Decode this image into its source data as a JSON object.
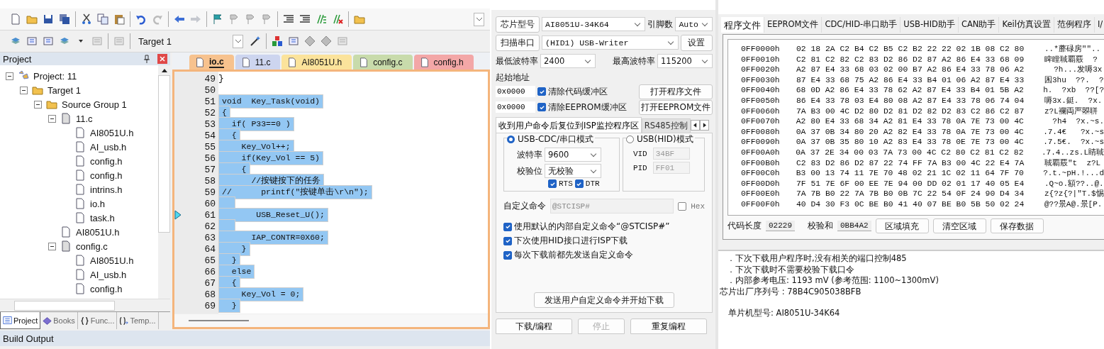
{
  "ide": {
    "target_select": "Target 1",
    "project_panel": {
      "title": "Project",
      "tree": [
        {
          "label": "Project: 11",
          "kind": "project",
          "expanded": true,
          "children": [
            {
              "label": "Target 1",
              "kind": "target",
              "expanded": true,
              "children": [
                {
                  "label": "Source Group 1",
                  "kind": "group",
                  "expanded": true,
                  "children": [
                    {
                      "label": "11.c",
                      "kind": "source",
                      "expanded": true,
                      "children": [
                        {
                          "label": "AI8051U.h",
                          "kind": "header"
                        },
                        {
                          "label": "AI_usb.h",
                          "kind": "header"
                        },
                        {
                          "label": "config.h",
                          "kind": "header"
                        },
                        {
                          "label": "config.h",
                          "kind": "header"
                        },
                        {
                          "label": "intrins.h",
                          "kind": "header"
                        },
                        {
                          "label": "io.h",
                          "kind": "header"
                        },
                        {
                          "label": "task.h",
                          "kind": "header"
                        }
                      ]
                    },
                    {
                      "label": "AI8051U.h",
                      "kind": "header"
                    },
                    {
                      "label": "config.c",
                      "kind": "source",
                      "expanded": true,
                      "children": [
                        {
                          "label": "AI8051U.h",
                          "kind": "header"
                        },
                        {
                          "label": "AI_usb.h",
                          "kind": "header"
                        },
                        {
                          "label": "config.h",
                          "kind": "header"
                        }
                      ]
                    }
                  ]
                }
              ]
            }
          ]
        }
      ],
      "tabs": [
        {
          "label": "Project",
          "kind": "project",
          "selected": true
        },
        {
          "label": "Books",
          "kind": "books",
          "selected": false
        },
        {
          "label": "Func...",
          "kind": "functions",
          "selected": false
        },
        {
          "label": "Temp...",
          "kind": "templates",
          "selected": false
        }
      ]
    },
    "editor_tabs": [
      {
        "label": "io.c",
        "color": "#f7c28e",
        "selected": true
      },
      {
        "label": "11.c",
        "color": "#cdd5ef",
        "selected": false
      },
      {
        "label": "AI8051U.h",
        "color": "#fbe39b",
        "selected": false
      },
      {
        "label": "config.c",
        "color": "#c8dbab",
        "selected": false
      },
      {
        "label": "config.h",
        "color": "#f3a7a7",
        "selected": false
      }
    ],
    "code": [
      {
        "number": "49",
        "text": "}",
        "selected": false,
        "current": false
      },
      {
        "number": "50",
        "selected": false,
        "current": false
      },
      {
        "number": "51",
        "text": "void  Key_Task(void)",
        "selected": true,
        "current": false
      },
      {
        "number": "52",
        "text": "{",
        "selected": true,
        "current": false
      },
      {
        "number": "53",
        "text": "  if( P33==0 )",
        "selected": true,
        "current": false
      },
      {
        "number": "54",
        "text": "  {",
        "selected": true,
        "current": false
      },
      {
        "number": "55",
        "text": "    Key_Vol++;",
        "selected": true,
        "current": false
      },
      {
        "number": "56",
        "text": "    if(Key_Vol == 5)",
        "selected": true,
        "current": false
      },
      {
        "number": "57",
        "text": "    {",
        "selected": true,
        "current": false
      },
      {
        "number": "58",
        "text": "      //按键按下的任务",
        "selected": true,
        "current": false
      },
      {
        "number": "59",
        "text": "//      printf(\"按键单击\\r\\n\");",
        "selected": true,
        "current": false
      },
      {
        "number": "60",
        "selected": true,
        "current": false
      },
      {
        "number": "61",
        "text": "       USB_Reset_U();",
        "selected": true,
        "current": true
      },
      {
        "number": "62",
        "selected": true,
        "current": false
      },
      {
        "number": "63",
        "text": "      IAP_CONTR=0X60;",
        "selected": true,
        "current": false
      },
      {
        "number": "64",
        "text": "    }",
        "selected": true,
        "current": false
      },
      {
        "number": "65",
        "text": "  }",
        "selected": true,
        "current": false
      },
      {
        "number": "66",
        "text": "  else",
        "selected": true,
        "current": false
      },
      {
        "number": "67",
        "text": "  {",
        "selected": true,
        "current": false
      },
      {
        "number": "68",
        "text": "    Key_Vol = 0;",
        "selected": true,
        "current": false
      },
      {
        "number": "69",
        "text": "  }",
        "selected": true,
        "current": false
      }
    ],
    "build_output": {
      "title": "Build Output"
    }
  },
  "isp": {
    "chip_button": "芯片型号",
    "chip_select": "AI8051U-34K64",
    "pins_label": "引脚数",
    "pins_select": "Auto",
    "scan_button": "扫描串口",
    "port_select": "(HID1) USB-Writer",
    "settings_button": "设置",
    "min_baud_label": "最低波特率",
    "min_baud": "2400",
    "max_baud_label": "最高波特率",
    "max_baud": "115200",
    "start_address_label": "起始地址",
    "address_rows": [
      {
        "address": "0x0000",
        "label": "清除代码缓冲区",
        "checked": true,
        "button": "打开程序文件"
      },
      {
        "address": "0x0000",
        "label": "清除EEPROM缓冲区",
        "checked": true,
        "button": "打开EEPROM文件"
      }
    ],
    "tabs": [
      {
        "label": "收到用户命令后复位到ISP监控程序区",
        "selected": true
      },
      {
        "label": "RS485控制",
        "selected": false
      }
    ],
    "modes": [
      {
        "kind": "cdc",
        "label": "USB-CDC/串口模式",
        "selected": true,
        "baud_label": "波特率",
        "baud": "9600",
        "parity_label": "校验位",
        "parity": "无校验",
        "flags": [
          {
            "label": "RTS",
            "checked": true
          },
          {
            "label": "DTR",
            "checked": true
          }
        ]
      },
      {
        "kind": "hid",
        "label": "USB(HID)模式",
        "selected": false,
        "vid_label": "VID",
        "vid": "34BF",
        "pid_label": "PID",
        "pid": "FF01",
        "disabled": true
      }
    ],
    "custom_command": {
      "label": "自定义命令",
      "value": "@STCISP#",
      "hex_label": "Hex",
      "hex_checked": false
    },
    "options": [
      {
        "label": "使用默认的内部自定义命令“@STCISP#”",
        "checked": true
      },
      {
        "label": "下次使用HID接口进行ISP下载",
        "checked": true
      },
      {
        "label": "每次下载前都先发送自定义命令",
        "checked": true
      }
    ],
    "send_button": "发送用户自定义命令并开始下载",
    "actions": [
      {
        "label": "下载/编程",
        "disabled": false
      },
      {
        "label": "停止",
        "disabled": true
      },
      {
        "label": "重复编程",
        "disabled": false
      }
    ]
  },
  "program": {
    "tabs": [
      {
        "label": "程序文件",
        "selected": true
      },
      {
        "label": "EEPROM文件",
        "selected": false
      },
      {
        "label": "CDC/HID-串口助手",
        "selected": false
      },
      {
        "label": "USB-HID助手",
        "selected": false
      },
      {
        "label": "CAN助手",
        "selected": false
      },
      {
        "label": "Keil仿真设置",
        "selected": false
      },
      {
        "label": "范例程序",
        "selected": false
      },
      {
        "label": "I/",
        "selected": false
      }
    ],
    "hex_rows": [
      {
        "address": "0FF0000h",
        "bytes": "02 18 2A C2 B4 C2 B5 C2 B2 22 22 02 1B 08 C2 80",
        "ascii": "..*蘼碌房\"\".."
      },
      {
        "address": "0FF0010h",
        "bytes": "C2 81 C2 82 C2 83 D2 86 D2 87 A2 86 E4 33 68 09",
        "ascii": "睥瞠聝覇覈  ?"
      },
      {
        "address": "0FF0020h",
        "bytes": "A2 87 E4 33 68 03 02 00 B7 A2 86 E4 33 78 06 A2",
        "ascii": "  ?h...发嗕3x"
      },
      {
        "address": "0FF0030h",
        "bytes": "87 E4 33 68 75 A2 86 E4 33 B4 01 06 A2 87 E4 33",
        "ascii": "囷3hu  ??.  ?"
      },
      {
        "address": "0FF0040h",
        "bytes": "68 0D A2 86 E4 33 78 62 A2 87 E4 33 B4 01 5B A2",
        "ascii": "h.  ?xb  ??[?"
      },
      {
        "address": "0FF0050h",
        "bytes": "86 E4 33 78 03 E4 80 08 A2 87 E4 33 78 06 74 04",
        "ascii": "嗕3x.鋌.  ?x."
      },
      {
        "address": "0FF0060h",
        "bytes": "7A B3 00 4C D2 80 D2 81 D2 82 D2 83 C2 86 C2 87",
        "ascii": "z?L襴両严曌聠"
      },
      {
        "address": "0FF0070h",
        "bytes": "A2 80 E4 33 68 34 A2 81 E4 33 78 0A 7E 73 00 4C",
        "ascii": "  ?h4  ?x.~s."
      },
      {
        "address": "0FF0080h",
        "bytes": "0A 37 0B 34 80 20 A2 82 E4 33 78 0A 7E 73 00 4C",
        "ascii": ".7.4€   ?x.~s"
      },
      {
        "address": "0FF0090h",
        "bytes": "0A 37 0B 35 80 10 A2 83 E4 33 78 0E 7E 73 00 4C",
        "ascii": ".7.5€.  ?x.~s"
      },
      {
        "address": "0FF00A0h",
        "bytes": "0A 37 2E 34 00 03 7A 73 00 4C C2 80 C2 81 C2 82",
        "ascii": ".7.4..zs.L睛聝"
      },
      {
        "address": "0FF00B0h",
        "bytes": "C2 83 D2 86 D2 87 22 74 FF 7A B3 00 4C 22 E4 7A",
        "ascii": "聝覇覈\"t  z?L"
      },
      {
        "address": "0FF00C0h",
        "bytes": "B3 00 13 74 11 7E 70 48 02 21 1C 02 11 64 7F 70",
        "ascii": "?.t.~pH.!...d"
      },
      {
        "address": "0FF00D0h",
        "bytes": "7F 51 7E 6F 00 EE 7E 94 00 DD 02 01 17 40 05 E4",
        "ascii": ".Q~o.額??..@."
      },
      {
        "address": "0FF00E0h",
        "bytes": "7A 7B B0 22 7A 7B B0 0B 7C 22 54 0F 24 90 D4 34",
        "ascii": "z{?z{?|\"T.$惕"
      },
      {
        "address": "0FF00F0h",
        "bytes": "40 D4 30 F3 0C BE B0 41 40 07 BE B0 5B 50 02 24",
        "ascii": "@??景A@.景[P."
      }
    ],
    "code_length_label": "代码长度",
    "code_length": "02229",
    "checksum_label": "校验和",
    "checksum": "0BB4A2",
    "buttons": [
      "区域填充",
      "清空区域",
      "保存数据"
    ],
    "log": [
      {
        "kind": "bullet",
        "text": "．下次下载用户程序时,没有相关的端口控制485"
      },
      {
        "kind": "bullet",
        "text": "．下次下载时不需要校验下载口令"
      },
      {
        "kind": "bullet",
        "text": "．内部参考电压: 1193 mV (参考范围: 1100~1300mV)"
      },
      {
        "kind": "plain",
        "text": "芯片出厂序列号 : 78B4C905038BFB"
      },
      {
        "kind": "spaced",
        "text": "单片机型号: AI8051U-34K64"
      }
    ]
  }
}
